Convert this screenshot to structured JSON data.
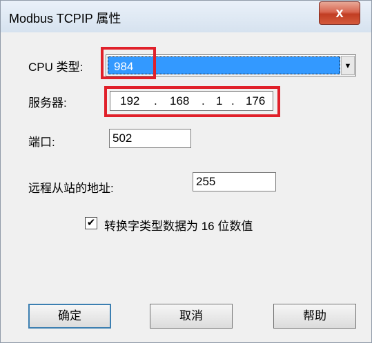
{
  "window": {
    "title": "Modbus TCPIP 属性",
    "close_icon": "close-icon",
    "close_glyph": "x"
  },
  "form": {
    "cpu_type": {
      "label": "CPU 类型:",
      "value": "984",
      "dropdown_icon": "chevron-down-icon",
      "dropdown_glyph": "▼"
    },
    "server": {
      "label": "服务器:",
      "ip": [
        "192",
        "168",
        "1",
        "176"
      ],
      "separator": "."
    },
    "port": {
      "label": "端口:",
      "value": "502"
    },
    "remote_station": {
      "label": "远程从站的地址:",
      "value": "255"
    },
    "convert_checkbox": {
      "label": "转换字类型数据为 16 位数值",
      "checked": true,
      "check_glyph": "✔"
    }
  },
  "buttons": {
    "ok": "确定",
    "cancel": "取消",
    "help": "帮助"
  },
  "highlight_color": "#e0202a",
  "selection_color": "#3399ff"
}
